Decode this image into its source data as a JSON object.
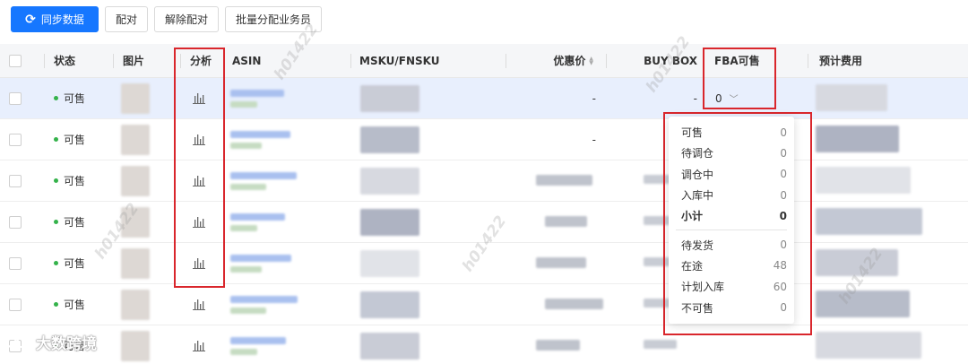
{
  "toolbar": {
    "sync_label": "同步数据",
    "match_label": "配对",
    "unmatch_label": "解除配对",
    "batch_assign_label": "批量分配业务员"
  },
  "columns": {
    "status": "状态",
    "image": "图片",
    "analysis": "分析",
    "asin": "ASIN",
    "msku": "MSKU/FNSKU",
    "discount_price": "优惠价",
    "buybox": "BUY BOX",
    "fba_available": "FBA可售",
    "est_fee": "预计费用"
  },
  "rows": [
    {
      "status": "可售",
      "price": "-",
      "buybox": "-",
      "fba": "0"
    },
    {
      "status": "可售",
      "price": "-",
      "buybox": "",
      "fba": ""
    },
    {
      "status": "可售",
      "price": "",
      "buybox": "",
      "fba": ""
    },
    {
      "status": "可售",
      "price": "",
      "buybox": "",
      "fba": ""
    },
    {
      "status": "可售",
      "price": "",
      "buybox": "",
      "fba": ""
    },
    {
      "status": "可售",
      "price": "",
      "buybox": "",
      "fba": ""
    },
    {
      "status": "可售",
      "price": "",
      "buybox": "",
      "fba": ""
    }
  ],
  "fba_popover": {
    "group1": [
      {
        "label": "可售",
        "value": "0"
      },
      {
        "label": "待调仓",
        "value": "0"
      },
      {
        "label": "调仓中",
        "value": "0"
      },
      {
        "label": "入库中",
        "value": "0"
      }
    ],
    "subtotal": {
      "label": "小计",
      "value": "0"
    },
    "group2": [
      {
        "label": "待发货",
        "value": "0"
      },
      {
        "label": "在途",
        "value": "48"
      },
      {
        "label": "计划入库",
        "value": "60"
      },
      {
        "label": "不可售",
        "value": "0"
      }
    ]
  },
  "watermark": {
    "text": "h01422",
    "brand": "大数跨境"
  },
  "colors": {
    "primary": "#1677ff",
    "highlight_row": "#e8effd",
    "status_dot": "#34b24a",
    "annotation_red": "#d9262c"
  }
}
